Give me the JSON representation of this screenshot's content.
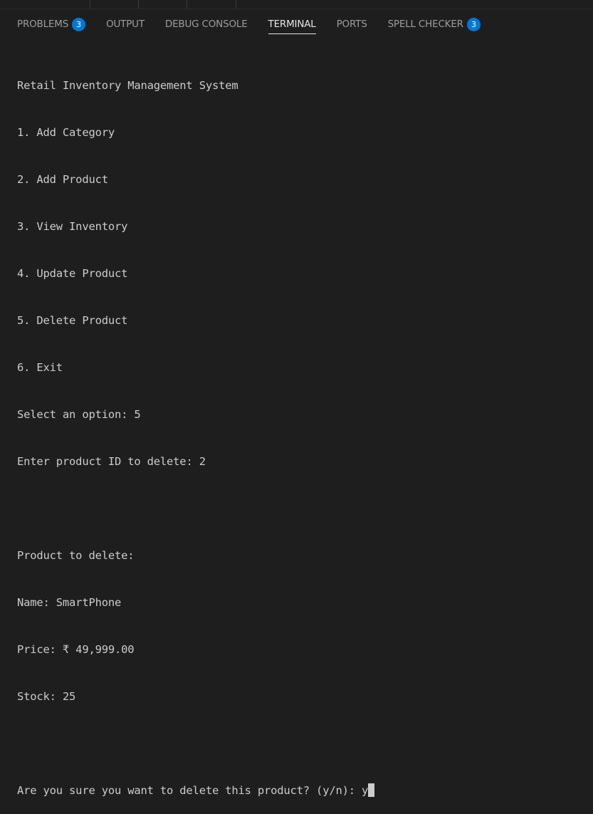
{
  "panel": {
    "tabs": [
      {
        "label": "PROBLEMS",
        "badge": "3"
      },
      {
        "label": "OUTPUT"
      },
      {
        "label": "DEBUG CONSOLE"
      },
      {
        "label": "TERMINAL"
      },
      {
        "label": "PORTS"
      },
      {
        "label": "SPELL CHECKER",
        "badge": "3"
      }
    ],
    "active_tab": "TERMINAL"
  },
  "terminal": {
    "lines": [
      "Retail Inventory Management System",
      "1. Add Category",
      "2. Add Product",
      "3. View Inventory",
      "4. Update Product",
      "5. Delete Product",
      "6. Exit",
      "Select an option: 5",
      "Enter product ID to delete: 2",
      "",
      "Product to delete:",
      "Name: SmartPhone",
      "Price: ₹ 49,999.00",
      "Stock: 25",
      "",
      "Are you sure you want to delete this product? (y/n): y"
    ]
  },
  "colors": {
    "background": "#1e1e1e",
    "text": "#cccccc",
    "badge": "#0078d4",
    "tab_inactive": "#9d9d9d",
    "tab_active": "#e7e7e7"
  }
}
